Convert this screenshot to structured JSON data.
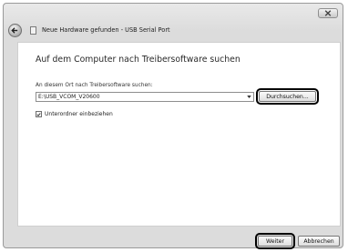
{
  "window": {
    "title": "Neue Hardware gefunden - USB Serial Port"
  },
  "content": {
    "heading": "Auf dem Computer nach Treibersoftware suchen",
    "search_label": "An diesem Ort nach Treibersoftware suchen:",
    "path_value": "E:\\USB_VCOM_V20600",
    "browse_button": "Durchsuchen...",
    "include_subfolders": {
      "label": "Unterordner einbeziehen",
      "checked": true
    }
  },
  "footer": {
    "next_button": "Weiter",
    "cancel_button": "Abbrechen"
  },
  "icons": {
    "back": "back-arrow-icon",
    "close": "close-icon",
    "dropdown": "chevron-down-icon",
    "check": "checkmark-icon",
    "hardware": "hardware-icon"
  }
}
